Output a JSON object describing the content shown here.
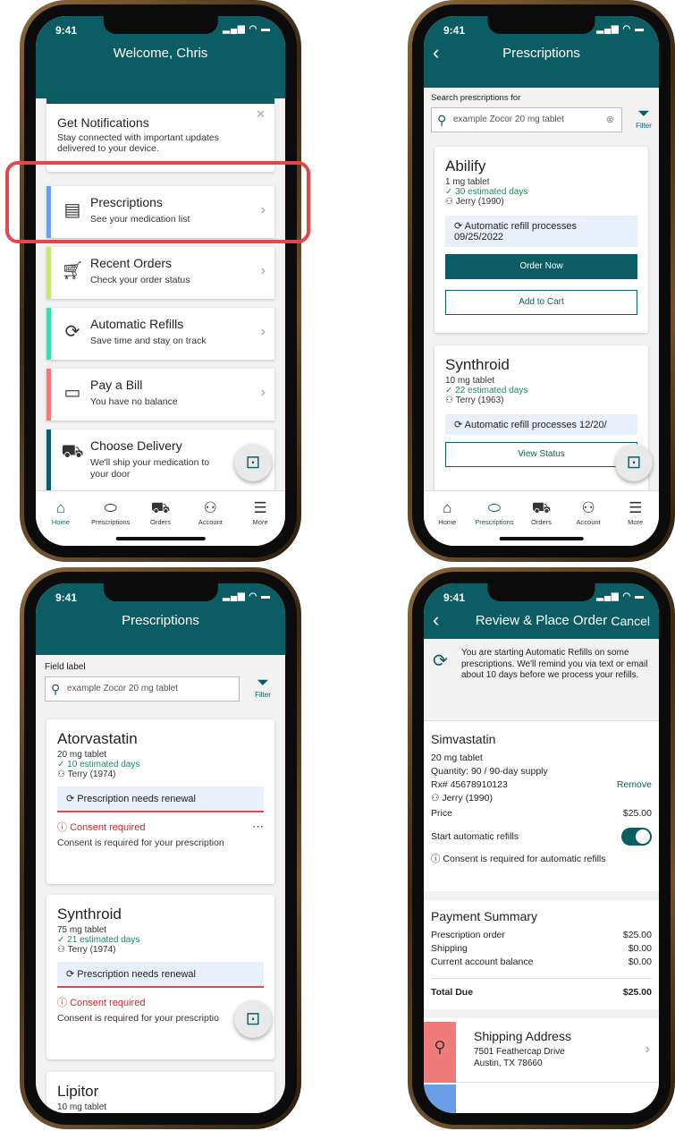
{
  "status": {
    "time": "9:41",
    "signal": "▂▄▆ ◠ ▬"
  },
  "colors": {
    "brand": "#0c5d63",
    "highlight": "#e0484e",
    "green": "#1e8a5a",
    "red": "#dd2222"
  },
  "home": {
    "title": "Welcome, Chris",
    "notification": {
      "title": "Get Notifications",
      "body": "Stay connected with important updates delivered to your device.",
      "close": "✕"
    },
    "tiles": [
      {
        "title": "Prescriptions",
        "subtitle": "See your medication list",
        "icon": "prescription-bottle-icon",
        "color": "#6a9ee8"
      },
      {
        "title": "Recent Orders",
        "subtitle": "Check your order status",
        "icon": "cart-icon",
        "color": "#c6e87a"
      },
      {
        "title": "Automatic Refills",
        "subtitle": "Save time and stay on track",
        "icon": "refill-icon",
        "color": "#3fd9b0"
      },
      {
        "title": "Pay a Bill",
        "subtitle": "You have no balance",
        "icon": "credit-card-icon",
        "color": "#ef7b7b"
      },
      {
        "title": "Choose Delivery",
        "subtitle": "We'll ship your medication to your door",
        "icon": "delivery-truck-icon",
        "color": "#0c5d63"
      }
    ]
  },
  "tabs": [
    {
      "label": "Home",
      "icon": "home-icon",
      "glyph": "⌂"
    },
    {
      "label": "Prescriptions",
      "icon": "pill-icon",
      "glyph": "⬭"
    },
    {
      "label": "Orders",
      "icon": "truck-icon",
      "glyph": "⛟"
    },
    {
      "label": "Account",
      "icon": "person-icon",
      "glyph": "⚇"
    },
    {
      "label": "More",
      "icon": "menu-icon",
      "glyph": "☰"
    }
  ],
  "rxlist": {
    "title": "Prescriptions",
    "search_label": "Search prescriptions for",
    "search_placeholder": "example Zocor 20 mg tablet",
    "filter": "Filter",
    "cards": [
      {
        "name": "Abilify",
        "dose": "1 mg tablet",
        "days": "30 estimated days",
        "patient": "Jerry (1990)",
        "note": "Automatic refill processes 09/25/2022",
        "primary": "Order Now",
        "secondary": "Add to Cart"
      },
      {
        "name": "Synthroid",
        "dose": "10 mg tablet",
        "days": "22 estimated days",
        "patient": "Terry (1963)",
        "note": "Automatic refill processes 12/20/",
        "secondary": "View Status"
      }
    ]
  },
  "rxconsent": {
    "title": "Prescriptions",
    "field_label": "Field label",
    "search_placeholder": "example Zocor 20 mg tablet",
    "filter": "Filter",
    "consent_title": "Consent required",
    "consent_body": "Consent is required for your prescription",
    "consent_body_2": "Consent is required for your prescriptio",
    "renewal": "Prescription needs renewal",
    "cards": [
      {
        "name": "Atorvastatin",
        "dose": "20 mg tablet",
        "days": "10 estimated days",
        "patient": "Terry (1974)"
      },
      {
        "name": "Synthroid",
        "dose": "75 mg tablet",
        "days": "21 estimated days",
        "patient": "Terry (1974)"
      },
      {
        "name": "Lipitor",
        "dose": "10 mg tablet"
      }
    ]
  },
  "review": {
    "title": "Review & Place Order",
    "cancel": "Cancel",
    "banner": "You are starting Automatic Refills on some prescriptions. We'll remind you via text or email about 10 days before we process your refills.",
    "drug": {
      "name": "Simvastatin",
      "dose": "20 mg tablet",
      "quantity": "Quantity: 90 / 90-day supply",
      "rx": "Rx# 45678910123",
      "remove": "Remove",
      "patient": "Jerry (1990)",
      "price_label": "Price",
      "price": "$25.00",
      "auto_label": "Start automatic refills",
      "consent": "Consent is required for automatic refills"
    },
    "payment": {
      "title": "Payment Summary",
      "rows": [
        {
          "label": "Prescription order",
          "value": "$25.00"
        },
        {
          "label": "Shipping",
          "value": "$0.00"
        },
        {
          "label": "Current account balance",
          "value": "$0.00"
        }
      ],
      "total_label": "Total Due",
      "total": "$25.00"
    },
    "shipping": {
      "title": "Shipping Address",
      "line1": "7501 Feathercap Drive",
      "line2": "Austin, TX 78660"
    }
  }
}
